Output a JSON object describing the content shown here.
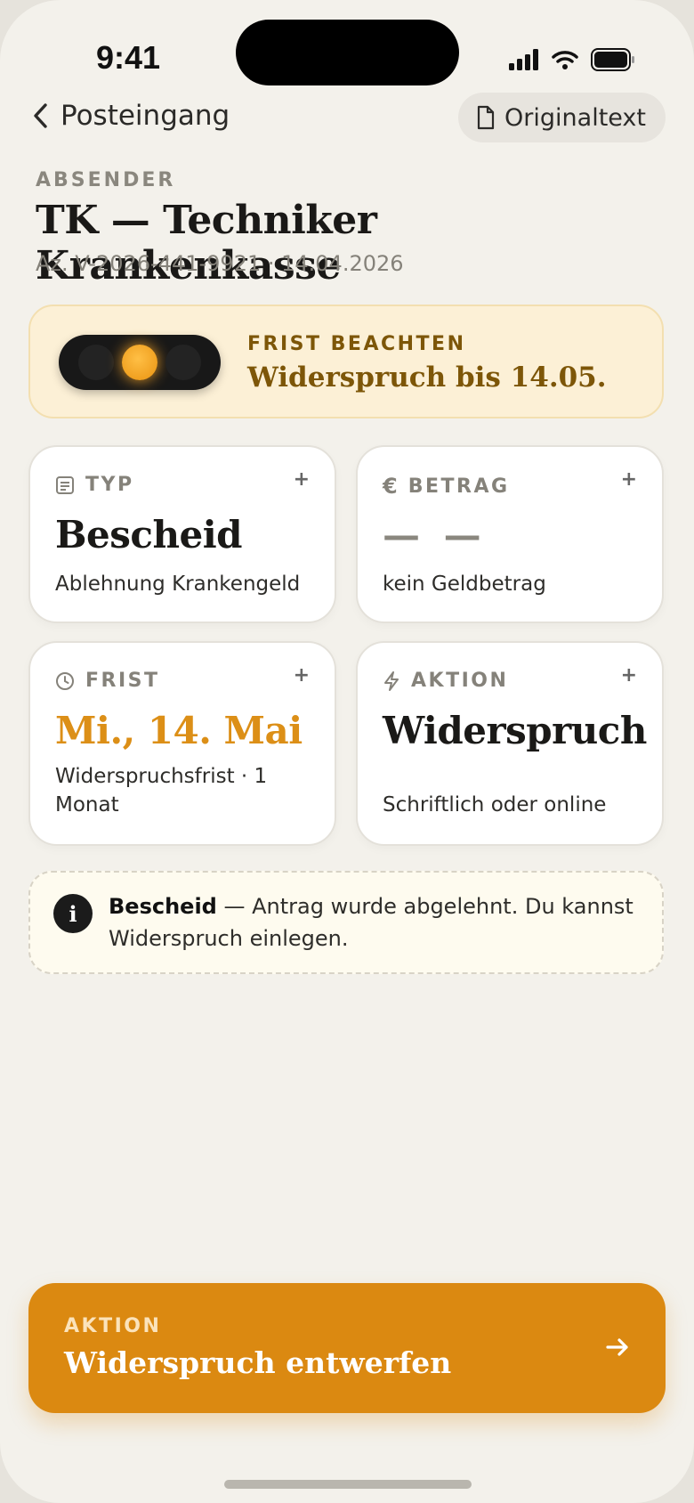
{
  "status_bar": {
    "time": "9:41"
  },
  "nav": {
    "back_label": "Posteingang",
    "original_label": "Originaltext"
  },
  "header": {
    "eyebrow": "ABSENDER",
    "sender": "TK — Techniker Krankenkasse",
    "meta": "Az. V-2026-441-9921 · 14.04.2026"
  },
  "alert": {
    "label": "FRIST BEACHTEN",
    "text": "Widerspruch bis 14.05.",
    "traffic_light_active": "amber"
  },
  "cards": [
    {
      "icon": "document-icon",
      "label": "TYP",
      "plus": "+",
      "value": "Bescheid",
      "sub": "Ablehnung Krankengeld"
    },
    {
      "icon": "euro-icon",
      "label": "BETRAG",
      "plus": "+",
      "value": "— —",
      "sub": "kein Geldbetrag"
    },
    {
      "icon": "clock-icon",
      "label": "FRIST",
      "plus": "+",
      "value": "Mi., 14. Mai",
      "sub": "Widerspruchsfrist · 1 Monat"
    },
    {
      "icon": "lightning-icon",
      "label": "AKTION",
      "plus": "+",
      "value": "Widerspruch",
      "sub": "Schriftlich oder online"
    }
  ],
  "info": {
    "icon": "info-icon",
    "strong": "Bescheid",
    "text": " — Antrag wurde abgelehnt. Du kannst Widerspruch einlegen."
  },
  "cta": {
    "label": "AKTION",
    "text": "Widerspruch entwerfen"
  },
  "colors": {
    "accent": "#DB8911",
    "alert_bg": "#FCF0D6",
    "alert_text": "#7D5608",
    "background": "#F3F1EB"
  }
}
